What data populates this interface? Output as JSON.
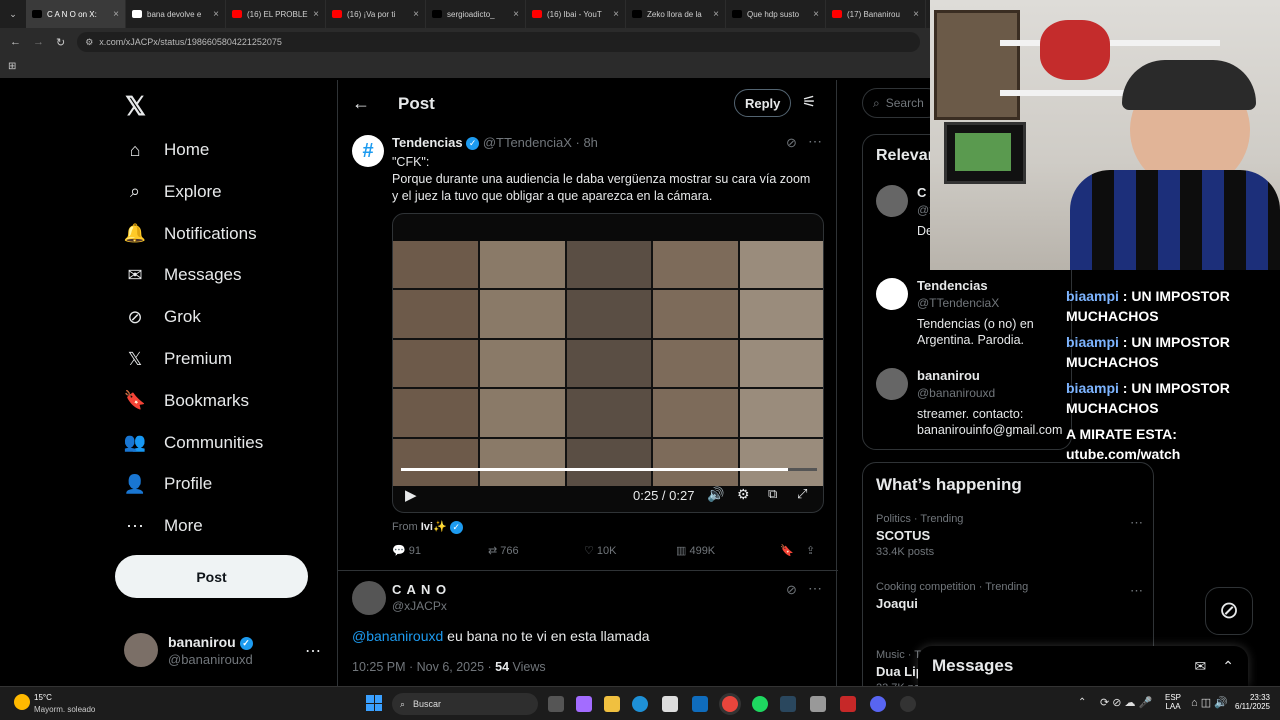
{
  "tabs": [
    {
      "label": "C A N O on X:",
      "color": "#000000",
      "active": true
    },
    {
      "label": "bana devolve e",
      "color": "#ffffff"
    },
    {
      "label": "(16) EL PROBLE",
      "color": "#ff0000"
    },
    {
      "label": "(16) ¡Va por ti",
      "color": "#ff0000"
    },
    {
      "label": "sergioadicto_",
      "color": "#000000"
    },
    {
      "label": "(16) Ibai - YouT",
      "color": "#ff0000"
    },
    {
      "label": "Zeko llora de la",
      "color": "#000000"
    },
    {
      "label": "Que hdp susto",
      "color": "#000000"
    },
    {
      "label": "(17) Bananirou",
      "color": "#ff0000"
    }
  ],
  "address": {
    "url": "x.com/xJACPx/status/1986605804221252075"
  },
  "nav": {
    "items": [
      {
        "label": "Home",
        "icon": "⌂"
      },
      {
        "label": "Explore",
        "icon": "⌕"
      },
      {
        "label": "Notifications",
        "icon": "🔔"
      },
      {
        "label": "Messages",
        "icon": "✉"
      },
      {
        "label": "Grok",
        "icon": "⊘"
      },
      {
        "label": "Premium",
        "icon": "𝕏"
      },
      {
        "label": "Bookmarks",
        "icon": "🔖"
      },
      {
        "label": "Communities",
        "icon": "👥"
      },
      {
        "label": "Profile",
        "icon": "👤"
      },
      {
        "label": "More",
        "icon": "⋯"
      }
    ],
    "post_label": "Post",
    "account": {
      "name": "bananirou",
      "handle": "@bananirouxd"
    }
  },
  "header": {
    "title": "Post",
    "reply_label": "Reply"
  },
  "tweet": {
    "name": "Tendencias",
    "handle": "@TTendenciaX",
    "time": "· 8h",
    "text_line1": "\"CFK\":",
    "text_line2": "Porque durante una audiencia le daba vergüenza mostrar su cara vía zoom",
    "text_line3": "y el juez la tuvo que obligar a que aparezca en la cámara.",
    "video_time": "0:25 / 0:27",
    "video_progress": 0.93,
    "from_prefix": "From",
    "from_user": "Ivi✨",
    "stats": {
      "replies": "91",
      "reposts": "766",
      "likes": "10K",
      "views": "499K"
    }
  },
  "reply": {
    "name": "C A N O",
    "handle": "@xJACPx",
    "mention": "@bananirouxd",
    "text": " eu bana no te vi en esta llamada",
    "meta": "10:25 PM · Nov 6, 2025 · ",
    "views": "54",
    "views_label": " Views"
  },
  "right": {
    "search_placeholder": "Search",
    "relevant_title": "Relevant",
    "people": [
      {
        "name": "C A",
        "handle": "@x",
        "bio": "De Mo"
      },
      {
        "name": "Tendencias",
        "handle": "@TTendenciaX",
        "bio": "Tendencias (o no) en Argentina. Parodia."
      },
      {
        "name": "bananirou",
        "handle": "@bananirouxd",
        "bio": "streamer. contacto: bananirouinfo@gmail.com"
      }
    ],
    "happening_title": "What’s happening",
    "trends": [
      {
        "context": "Politics · Trending",
        "topic": "SCOTUS",
        "posts": "33.4K posts"
      },
      {
        "context": "Cooking competition · Trending",
        "topic": "Joaqui",
        "posts": ""
      },
      {
        "context": "Music · Trending",
        "topic": "Dua Lip",
        "posts": "23.7K po"
      }
    ],
    "messages_label": "Messages"
  },
  "chat": [
    {
      "user": "biaampi",
      "text": " : UN IMPOSTOR MUCHACHOS"
    },
    {
      "user": "biaampi",
      "text": " : UN IMPOSTOR MUCHACHOS"
    },
    {
      "user": "biaampi",
      "text": " : UN IMPOSTOR MUCHACHOS"
    },
    {
      "user": "",
      "text": "A MIRATE ESTA:"
    },
    {
      "user": "",
      "text": "utube.com/watch"
    }
  ],
  "taskbar": {
    "weather_temp": "15°C",
    "weather_desc": "Mayorm. soleado",
    "search_placeholder": "Buscar",
    "lang": "ESP",
    "lang2": "LAA",
    "time": "23:33",
    "date": "6/11/2025"
  }
}
